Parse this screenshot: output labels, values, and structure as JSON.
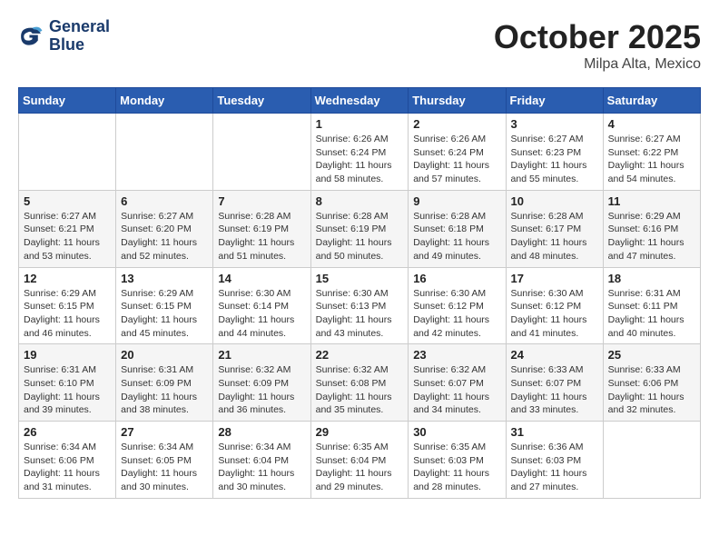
{
  "header": {
    "logo_line1": "General",
    "logo_line2": "Blue",
    "month": "October 2025",
    "location": "Milpa Alta, Mexico"
  },
  "weekdays": [
    "Sunday",
    "Monday",
    "Tuesday",
    "Wednesday",
    "Thursday",
    "Friday",
    "Saturday"
  ],
  "weeks": [
    [
      {
        "day": "",
        "info": ""
      },
      {
        "day": "",
        "info": ""
      },
      {
        "day": "",
        "info": ""
      },
      {
        "day": "1",
        "info": "Sunrise: 6:26 AM\nSunset: 6:24 PM\nDaylight: 11 hours\nand 58 minutes."
      },
      {
        "day": "2",
        "info": "Sunrise: 6:26 AM\nSunset: 6:24 PM\nDaylight: 11 hours\nand 57 minutes."
      },
      {
        "day": "3",
        "info": "Sunrise: 6:27 AM\nSunset: 6:23 PM\nDaylight: 11 hours\nand 55 minutes."
      },
      {
        "day": "4",
        "info": "Sunrise: 6:27 AM\nSunset: 6:22 PM\nDaylight: 11 hours\nand 54 minutes."
      }
    ],
    [
      {
        "day": "5",
        "info": "Sunrise: 6:27 AM\nSunset: 6:21 PM\nDaylight: 11 hours\nand 53 minutes."
      },
      {
        "day": "6",
        "info": "Sunrise: 6:27 AM\nSunset: 6:20 PM\nDaylight: 11 hours\nand 52 minutes."
      },
      {
        "day": "7",
        "info": "Sunrise: 6:28 AM\nSunset: 6:19 PM\nDaylight: 11 hours\nand 51 minutes."
      },
      {
        "day": "8",
        "info": "Sunrise: 6:28 AM\nSunset: 6:19 PM\nDaylight: 11 hours\nand 50 minutes."
      },
      {
        "day": "9",
        "info": "Sunrise: 6:28 AM\nSunset: 6:18 PM\nDaylight: 11 hours\nand 49 minutes."
      },
      {
        "day": "10",
        "info": "Sunrise: 6:28 AM\nSunset: 6:17 PM\nDaylight: 11 hours\nand 48 minutes."
      },
      {
        "day": "11",
        "info": "Sunrise: 6:29 AM\nSunset: 6:16 PM\nDaylight: 11 hours\nand 47 minutes."
      }
    ],
    [
      {
        "day": "12",
        "info": "Sunrise: 6:29 AM\nSunset: 6:15 PM\nDaylight: 11 hours\nand 46 minutes."
      },
      {
        "day": "13",
        "info": "Sunrise: 6:29 AM\nSunset: 6:15 PM\nDaylight: 11 hours\nand 45 minutes."
      },
      {
        "day": "14",
        "info": "Sunrise: 6:30 AM\nSunset: 6:14 PM\nDaylight: 11 hours\nand 44 minutes."
      },
      {
        "day": "15",
        "info": "Sunrise: 6:30 AM\nSunset: 6:13 PM\nDaylight: 11 hours\nand 43 minutes."
      },
      {
        "day": "16",
        "info": "Sunrise: 6:30 AM\nSunset: 6:12 PM\nDaylight: 11 hours\nand 42 minutes."
      },
      {
        "day": "17",
        "info": "Sunrise: 6:30 AM\nSunset: 6:12 PM\nDaylight: 11 hours\nand 41 minutes."
      },
      {
        "day": "18",
        "info": "Sunrise: 6:31 AM\nSunset: 6:11 PM\nDaylight: 11 hours\nand 40 minutes."
      }
    ],
    [
      {
        "day": "19",
        "info": "Sunrise: 6:31 AM\nSunset: 6:10 PM\nDaylight: 11 hours\nand 39 minutes."
      },
      {
        "day": "20",
        "info": "Sunrise: 6:31 AM\nSunset: 6:09 PM\nDaylight: 11 hours\nand 38 minutes."
      },
      {
        "day": "21",
        "info": "Sunrise: 6:32 AM\nSunset: 6:09 PM\nDaylight: 11 hours\nand 36 minutes."
      },
      {
        "day": "22",
        "info": "Sunrise: 6:32 AM\nSunset: 6:08 PM\nDaylight: 11 hours\nand 35 minutes."
      },
      {
        "day": "23",
        "info": "Sunrise: 6:32 AM\nSunset: 6:07 PM\nDaylight: 11 hours\nand 34 minutes."
      },
      {
        "day": "24",
        "info": "Sunrise: 6:33 AM\nSunset: 6:07 PM\nDaylight: 11 hours\nand 33 minutes."
      },
      {
        "day": "25",
        "info": "Sunrise: 6:33 AM\nSunset: 6:06 PM\nDaylight: 11 hours\nand 32 minutes."
      }
    ],
    [
      {
        "day": "26",
        "info": "Sunrise: 6:34 AM\nSunset: 6:06 PM\nDaylight: 11 hours\nand 31 minutes."
      },
      {
        "day": "27",
        "info": "Sunrise: 6:34 AM\nSunset: 6:05 PM\nDaylight: 11 hours\nand 30 minutes."
      },
      {
        "day": "28",
        "info": "Sunrise: 6:34 AM\nSunset: 6:04 PM\nDaylight: 11 hours\nand 30 minutes."
      },
      {
        "day": "29",
        "info": "Sunrise: 6:35 AM\nSunset: 6:04 PM\nDaylight: 11 hours\nand 29 minutes."
      },
      {
        "day": "30",
        "info": "Sunrise: 6:35 AM\nSunset: 6:03 PM\nDaylight: 11 hours\nand 28 minutes."
      },
      {
        "day": "31",
        "info": "Sunrise: 6:36 AM\nSunset: 6:03 PM\nDaylight: 11 hours\nand 27 minutes."
      },
      {
        "day": "",
        "info": ""
      }
    ]
  ]
}
